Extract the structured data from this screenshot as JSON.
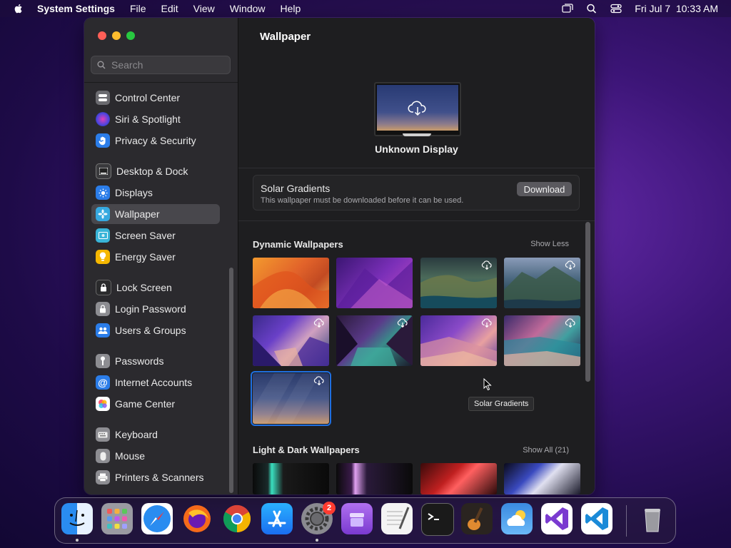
{
  "menubar": {
    "app_name": "System Settings",
    "menus": [
      "File",
      "Edit",
      "View",
      "Window",
      "Help"
    ],
    "clock": "Fri Jul 7  10:33 AM"
  },
  "sidebar": {
    "search_placeholder": "Search",
    "items": [
      {
        "label": "Control Center",
        "icon": "control-center-icon",
        "color": "#6b6b70"
      },
      {
        "label": "Siri & Spotlight",
        "icon": "siri-icon",
        "color": "#7a3fd8"
      },
      {
        "label": "Privacy & Security",
        "icon": "hand-icon",
        "color": "#2b7de9"
      },
      {
        "label": "Desktop & Dock",
        "icon": "desktop-dock-icon",
        "color": "#3a3a3d"
      },
      {
        "label": "Displays",
        "icon": "displays-icon",
        "color": "#2b7de9"
      },
      {
        "label": "Wallpaper",
        "icon": "wallpaper-icon",
        "color": "#36a9e0"
      },
      {
        "label": "Screen Saver",
        "icon": "screen-saver-icon",
        "color": "#39b5d8"
      },
      {
        "label": "Energy Saver",
        "icon": "energy-saver-icon",
        "color": "#f5b700"
      },
      {
        "label": "Lock Screen",
        "icon": "lock-icon",
        "color": "#3a3a3d"
      },
      {
        "label": "Login Password",
        "icon": "login-password-icon",
        "color": "#8d8d92"
      },
      {
        "label": "Users & Groups",
        "icon": "users-icon",
        "color": "#2b7de9"
      },
      {
        "label": "Passwords",
        "icon": "key-icon",
        "color": "#8d8d92"
      },
      {
        "label": "Internet Accounts",
        "icon": "at-icon",
        "color": "#2b7de9"
      },
      {
        "label": "Game Center",
        "icon": "game-center-icon",
        "color": "#ffffff"
      },
      {
        "label": "Keyboard",
        "icon": "keyboard-icon",
        "color": "#8d8d92"
      },
      {
        "label": "Mouse",
        "icon": "mouse-icon",
        "color": "#8d8d92"
      },
      {
        "label": "Printers & Scanners",
        "icon": "printer-icon",
        "color": "#8d8d92"
      }
    ],
    "active": "Wallpaper"
  },
  "content": {
    "title": "Wallpaper",
    "display_name": "Unknown Display",
    "download_card": {
      "title": "Solar Gradients",
      "subtitle": "This wallpaper must be downloaded before it can be used.",
      "button": "Download"
    },
    "dynamic": {
      "title": "Dynamic Wallpapers",
      "link": "Show Less"
    },
    "light_dark": {
      "title": "Light & Dark Wallpapers",
      "link": "Show All (21)"
    },
    "tooltip": "Solar Gradients"
  },
  "dock": {
    "apps": [
      "Finder",
      "Launchpad",
      "Safari",
      "Firefox",
      "Chrome",
      "App Store",
      "System Settings",
      "Archive",
      "TextEdit",
      "Terminal",
      "GarageBand",
      "Weather",
      "Visual Studio",
      "VS Code",
      "Trash"
    ],
    "settings_badge": "2"
  }
}
